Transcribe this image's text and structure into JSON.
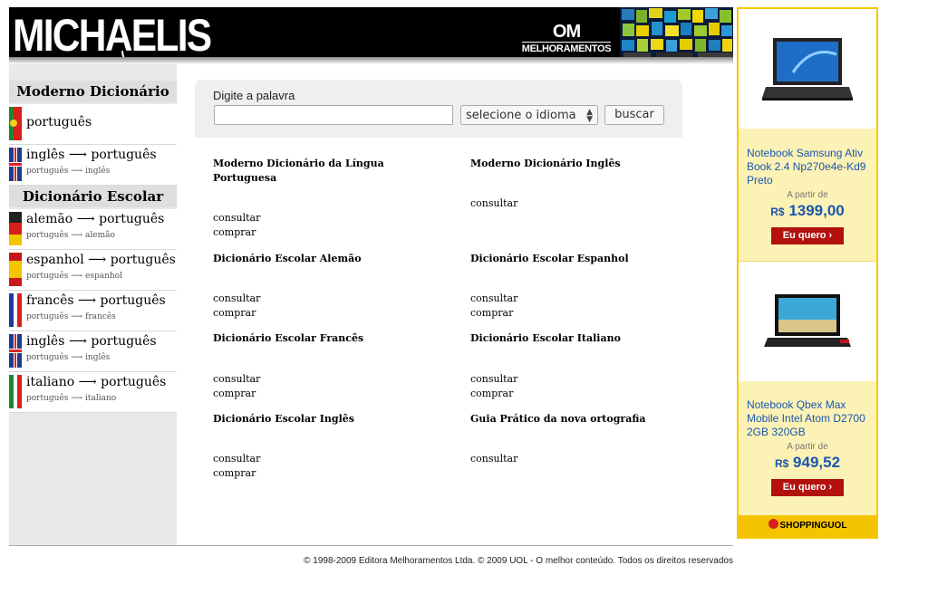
{
  "header": {
    "logo": "MICHAELIS",
    "brand_mark": "OM",
    "brand_name": "MELHORAMENTOS"
  },
  "sidebar": {
    "section1": "Moderno Dicionário",
    "section2": "Dicionário Escolar",
    "modern_items": [
      {
        "label": "português",
        "sub": ""
      },
      {
        "label": "inglês ⟶ português",
        "sub": "português ⟶ inglês"
      }
    ],
    "school_items": [
      {
        "label": "alemão ⟶ português",
        "sub": "português ⟶ alemão"
      },
      {
        "label": "espanhol ⟶ português",
        "sub": "português ⟶ espanhol"
      },
      {
        "label": "francês ⟶ português",
        "sub": "português ⟶ francês"
      },
      {
        "label": "inglês ⟶ português",
        "sub": "português ⟶ inglês"
      },
      {
        "label": "italiano ⟶ português",
        "sub": "português ⟶ italiano"
      }
    ]
  },
  "search": {
    "label": "Digite a palavra",
    "value": "",
    "select_value": "selecione o idioma",
    "button": "buscar"
  },
  "dictionaries": [
    {
      "title": "Moderno Dicionário da Língua Portuguesa",
      "links": [
        "consultar",
        "comprar"
      ]
    },
    {
      "title": "Moderno Dicionário Inglês",
      "links": [
        "consultar"
      ]
    },
    {
      "title": "Dicionário Escolar Alemão",
      "links": [
        "consultar",
        "comprar"
      ]
    },
    {
      "title": "Dicionário Escolar Espanhol",
      "links": [
        "consultar",
        "comprar"
      ]
    },
    {
      "title": "Dicionário Escolar Francês",
      "links": [
        "consultar",
        "comprar"
      ]
    },
    {
      "title": "Dicionário Escolar Italiano",
      "links": [
        "consultar",
        "comprar"
      ]
    },
    {
      "title": "Dicionário Escolar Inglês",
      "links": [
        "consultar",
        "comprar"
      ]
    },
    {
      "title": "Guia Prático da nova ortografia",
      "links": [
        "consultar"
      ]
    }
  ],
  "ad": {
    "products": [
      {
        "title": "Notebook Samsung Ativ Book 2.4 Np270e4e-Kd9 Preto",
        "from": "A partir de",
        "currency": "R$",
        "price": "1399,00",
        "button": "Eu quero ›"
      },
      {
        "title": "Notebook Qbex Max Mobile Intel Atom D2700 2GB 320GB",
        "from": "A partir de",
        "currency": "R$",
        "price": "949,52",
        "button": "Eu quero ›"
      }
    ],
    "footer": "SHOPPINGUOL"
  },
  "footer": {
    "text": "© 1998-2009 Editora Melhoramentos Ltda. © 2009 UOL - O melhor conteúdo. Todos os direitos reservados"
  },
  "colors": {
    "ad_border": "#f3c800",
    "ad_background": "#fdf2b5",
    "ad_link": "#1a56b0",
    "ad_button": "#b3110e"
  }
}
